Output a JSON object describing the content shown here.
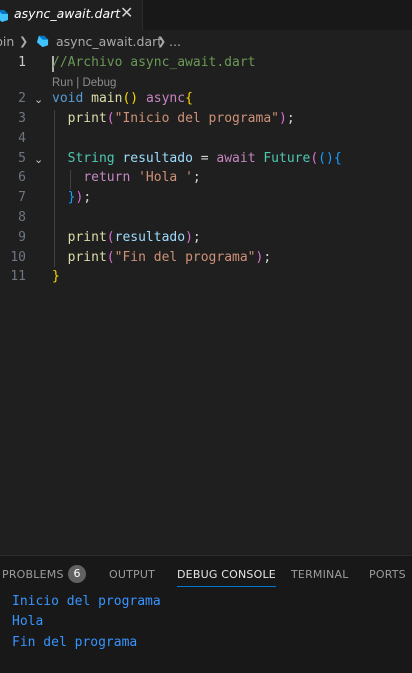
{
  "tab": {
    "label": "async_await.dart",
    "close": "✕"
  },
  "breadcrumb": {
    "folder": "bin",
    "file": "async_await.dart",
    "more": "..."
  },
  "editor": {
    "line_numbers": [
      "1",
      "2",
      "3",
      "4",
      "5",
      "6",
      "7",
      "8",
      "9",
      "10",
      "11"
    ],
    "codelens": "Run | Debug",
    "comment": "//Archivo async_await.dart",
    "kw_void": "void",
    "fn_main": "main",
    "kw_async": "async",
    "fn_print": "print",
    "str_inicio": "\"Inicio del programa\"",
    "type_string": "String",
    "var_resultado": "resultado",
    "kw_await": "await",
    "type_future": "Future",
    "kw_return": "return",
    "str_hola": "'Hola '",
    "str_fin": "\"Fin del programa\""
  },
  "panel": {
    "tabs": [
      "PROBLEMS",
      "OUTPUT",
      "DEBUG CONSOLE",
      "TERMINAL",
      "PORTS"
    ],
    "problems_count": "6",
    "output_lines": [
      "Inicio del programa",
      "Hola",
      "Fin del programa"
    ]
  },
  "colors": {
    "output_text": "#3794ff",
    "active_tab_underline": "#0078d4"
  }
}
